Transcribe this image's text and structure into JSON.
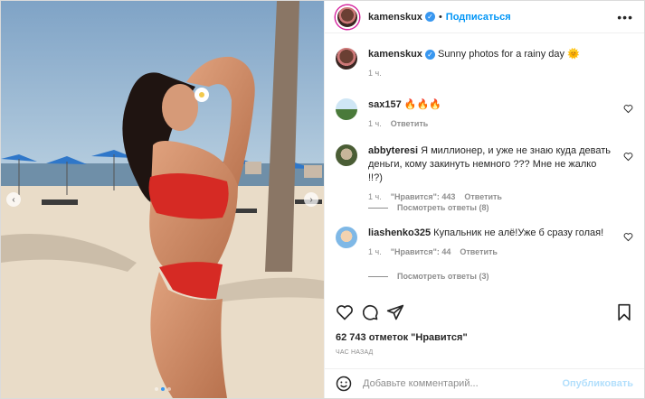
{
  "header": {
    "username": "kamenskux",
    "separator": "•",
    "follow_label": "Подписаться",
    "more_label": "•••"
  },
  "caption": {
    "username": "kamenskux",
    "text": "Sunny photos for a rainy day 🌞",
    "time": "1 ч."
  },
  "comments": [
    {
      "username": "sax157",
      "text": "🔥🔥🔥",
      "time": "1 ч.",
      "reply_label": "Ответить"
    },
    {
      "username": "abbyteresi",
      "text": "Я миллионер, и уже не знаю куда девать деньги, кому закинуть немного ??? Мне не жалко !!?)",
      "time": "1 ч.",
      "likes": "\"Нравится\": 443",
      "reply_label": "Ответить",
      "view_replies": "Посмотреть ответы (8)"
    },
    {
      "username": "liashenko325",
      "text": "Купальник не алё!Уже б сразу голая!",
      "time": "1 ч.",
      "likes": "\"Нравится\": 44",
      "reply_label": "Ответить",
      "view_replies": "Посмотреть ответы (3)"
    }
  ],
  "likes_text": "62 743 отметок \"Нравится\"",
  "posted_time": "ЧАС НАЗАД",
  "comment_box": {
    "placeholder": "Добавьте комментарий...",
    "publish_label": "Опубликовать"
  },
  "icons": {
    "prev": "chevron-left-icon",
    "next": "chevron-right-icon",
    "like": "heart-icon",
    "comment": "comment-icon",
    "share": "share-icon",
    "save": "bookmark-icon",
    "emoji": "emoji-icon"
  },
  "carousel": {
    "total": 3,
    "active": 2
  },
  "colors": {
    "accent": "#0095f6",
    "verified": "#3897f0",
    "muted": "#8e8e8e"
  }
}
